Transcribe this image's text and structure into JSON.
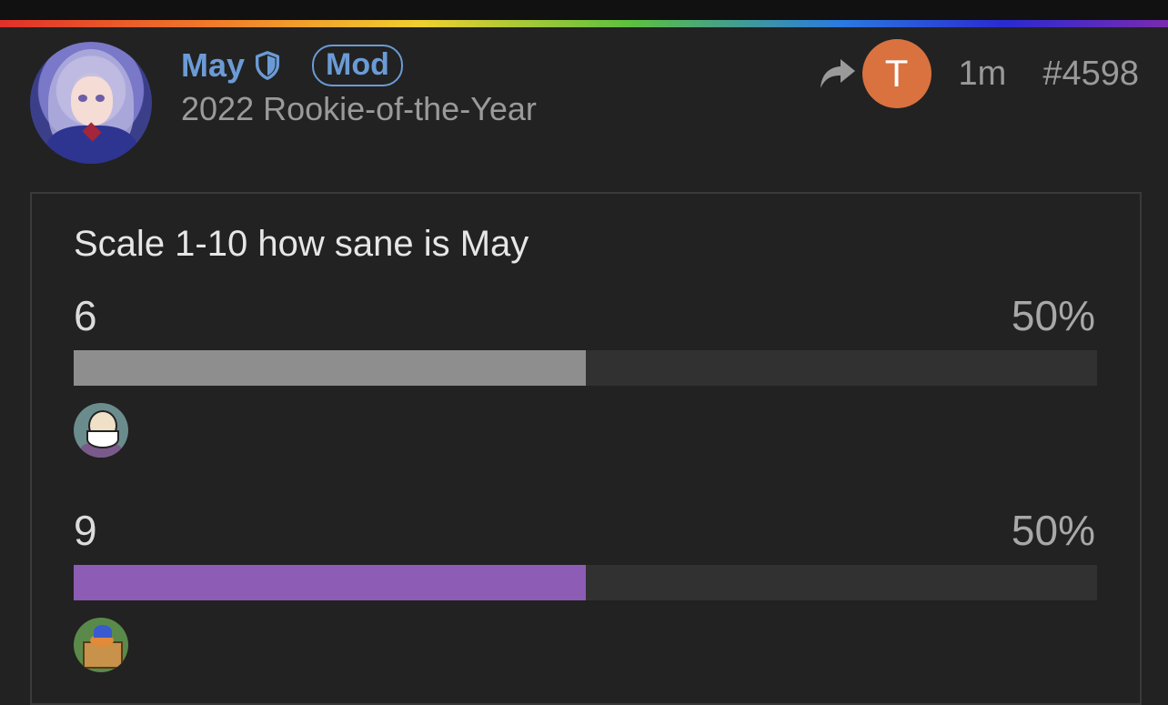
{
  "post": {
    "author": {
      "username": "May",
      "badge": "Mod",
      "title": "2022 Rookie-of-the-Year"
    },
    "meta": {
      "reply_avatar_letter": "T",
      "reply_avatar_color": "#d9723f",
      "time": "1m",
      "post_number": "#4598"
    }
  },
  "poll": {
    "question": "Scale 1-10 how sane is May",
    "options": [
      {
        "label": "6",
        "percent": "50%",
        "fraction": 0.5,
        "bar_color": "#8e8e8e"
      },
      {
        "label": "9",
        "percent": "50%",
        "fraction": 0.5,
        "bar_color": "#8d5cb4"
      }
    ]
  },
  "colors": {
    "username": "#6b9bd6",
    "background": "#222222"
  },
  "icons": {
    "moderator": "shield-icon",
    "reply": "reply-arrow-icon"
  }
}
